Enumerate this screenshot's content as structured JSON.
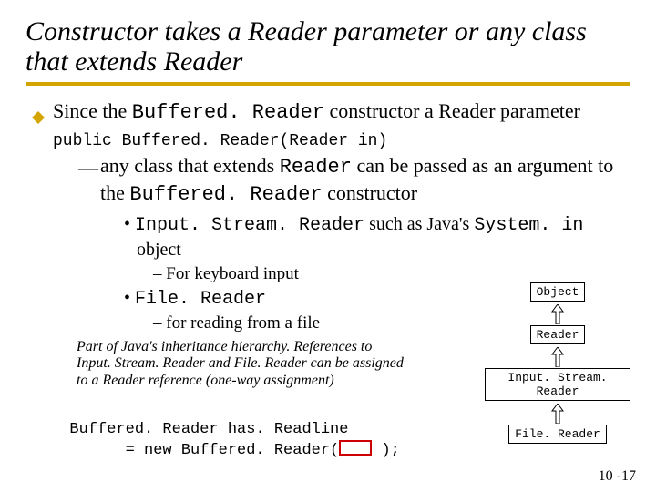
{
  "title": "Constructor takes a Reader parameter or any class that extends Reader",
  "bullet1": {
    "pre": "Since the ",
    "code1": "Buffered. Reader",
    "mid1": " constructor a Reader parameter ",
    "sig": "public Buffered. Reader(Reader in)"
  },
  "sub1": {
    "pre": "any class that extends ",
    "code1": "Reader",
    "mid": " can be passed as an argument to the ",
    "code2": "Buffered. Reader",
    "post": " constructor"
  },
  "dot_a": {
    "code": "Input. Stream. Reader",
    "mid": " such as Java's ",
    "code2": "System. in",
    "post": " object"
  },
  "dash_a": "For keyboard input",
  "dot_b": {
    "code": "File. Reader"
  },
  "dash_b": "for reading from a file",
  "caption": "Part of Java's inheritance hierarchy. References to Input. Stream. Reader and File. Reader can be assigned to a Reader reference (one-way assignment)",
  "code": {
    "line1": "Buffered. Reader has. Readline",
    "line2_pre": "        = new Buffered. Reader(",
    "line2_post": " );"
  },
  "hier": {
    "n1": "Object",
    "n2": "Reader",
    "n3": "Input. Stream. Reader",
    "n4": "File. Reader"
  },
  "page_num": "10 -17"
}
